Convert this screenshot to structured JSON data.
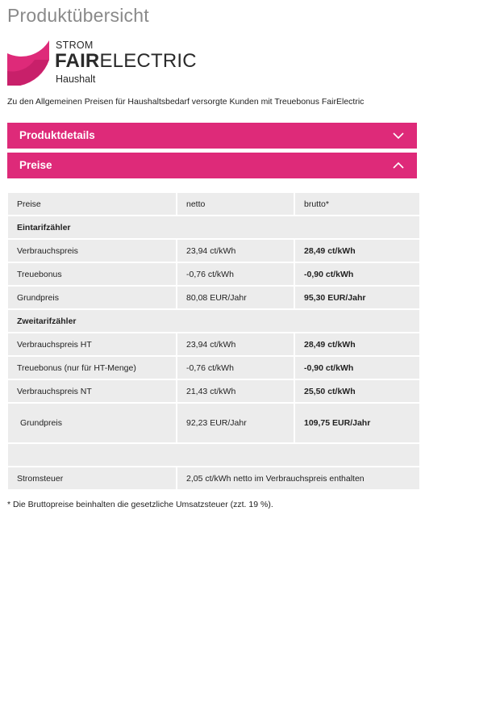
{
  "page": {
    "title": "Produktübersicht"
  },
  "logo": {
    "line1": "STROM",
    "brand_bold": "FAIR",
    "brand_regular": "ELECTRIC",
    "line3": "Haushalt",
    "color": "#de2a79"
  },
  "intro": "Zu den Allgemeinen Preisen für Haushaltsbedarf versorgte Kunden mit Treuebonus FairElectric",
  "accordion": {
    "details_label": "Produktdetails",
    "details_icon": "chevron-down-icon",
    "prices_label": "Preise",
    "prices_icon": "chevron-up-icon",
    "accent": "#de2a79"
  },
  "table": {
    "header": [
      "Preise",
      "netto",
      "brutto*"
    ],
    "section1": "Eintarifzähler",
    "rows1": [
      [
        "Verbrauchspreis",
        "23,94 ct/kWh",
        "28,49 ct/kWh"
      ],
      [
        "Treuebonus",
        "-0,76 ct/kWh",
        "-0,90 ct/kWh"
      ],
      [
        "Grundpreis",
        "80,08 EUR/Jahr",
        "95,30 EUR/Jahr"
      ]
    ],
    "section2": "Zweitarifzähler",
    "rows2": [
      [
        "Verbrauchspreis HT",
        "23,94 ct/kWh",
        "28,49 ct/kWh"
      ],
      [
        "Treuebonus (nur für HT-Menge)",
        "-0,76 ct/kWh",
        "-0,90 ct/kWh"
      ],
      [
        "Verbrauchspreis NT",
        "21,43 ct/kWh",
        "25,50 ct/kWh"
      ],
      [
        "Grundpreis",
        "92,23 EUR/Jahr",
        "109,75 EUR/Jahr"
      ]
    ],
    "tax_label": "Stromsteuer",
    "tax_value": "2,05 ct/kWh netto im Verbrauchspreis enthalten"
  },
  "footnote": "* Die Bruttopreise beinhalten die gesetzliche Umsatzsteuer (zzt. 19 %)."
}
